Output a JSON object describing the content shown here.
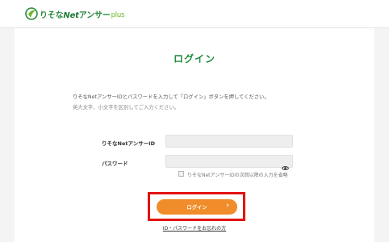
{
  "header": {
    "logo_main": "りそな",
    "logo_net": "Net",
    "logo_rest": "アンサー",
    "logo_plus": "plus"
  },
  "page": {
    "title": "ログイン",
    "description": "りそなNetアンサーIDとパスワードを入力して「ログイン」ボタンを押してください。",
    "case_note": "英大文字、小文字を区別してご入力ください。"
  },
  "form": {
    "id_label": "りそなNetアンサーID",
    "id_value": "",
    "password_label": "パスワード",
    "password_value": "",
    "password_icon": "eye-icon",
    "remember_label": "りそなNetアンサーIDの次回以降の入力を省略",
    "remember_checked": false
  },
  "actions": {
    "login_label": "ログイン",
    "login_arrow": "›",
    "forgot_link": "ID・パスワードをお忘れの方"
  },
  "colors": {
    "brand_green": "#1d8a3e",
    "login_orange": "#f08c2a",
    "highlight_red": "#e31212"
  }
}
